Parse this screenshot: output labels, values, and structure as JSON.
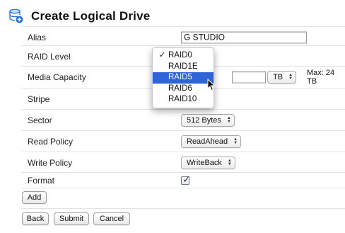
{
  "header": {
    "title": "Create Logical Drive",
    "icon": "database-add-icon"
  },
  "form": {
    "alias": {
      "label": "Alias",
      "value": "G STUDIO"
    },
    "raid_level": {
      "label": "RAID Level"
    },
    "media_capacity": {
      "label": "Media Capacity",
      "unit": "TB",
      "max_text": "Max: 24 TB"
    },
    "stripe": {
      "label": "Stripe"
    },
    "sector": {
      "label": "Sector",
      "value": "512 Bytes"
    },
    "read_policy": {
      "label": "Read Policy",
      "value": "ReadAhead"
    },
    "write_policy": {
      "label": "Write Policy",
      "value": "WriteBack"
    },
    "format": {
      "label": "Format",
      "checked": true
    }
  },
  "buttons": {
    "add": "Add",
    "back": "Back",
    "submit": "Submit",
    "cancel": "Cancel"
  },
  "raid_dropdown": {
    "options": [
      "RAID0",
      "RAID1E",
      "RAID5",
      "RAID6",
      "RAID10"
    ],
    "checked": "RAID0",
    "highlighted": "RAID5",
    "check_mark": "✓"
  },
  "colors": {
    "highlight": "#2f63d8",
    "icon": "#1f6fd6"
  }
}
